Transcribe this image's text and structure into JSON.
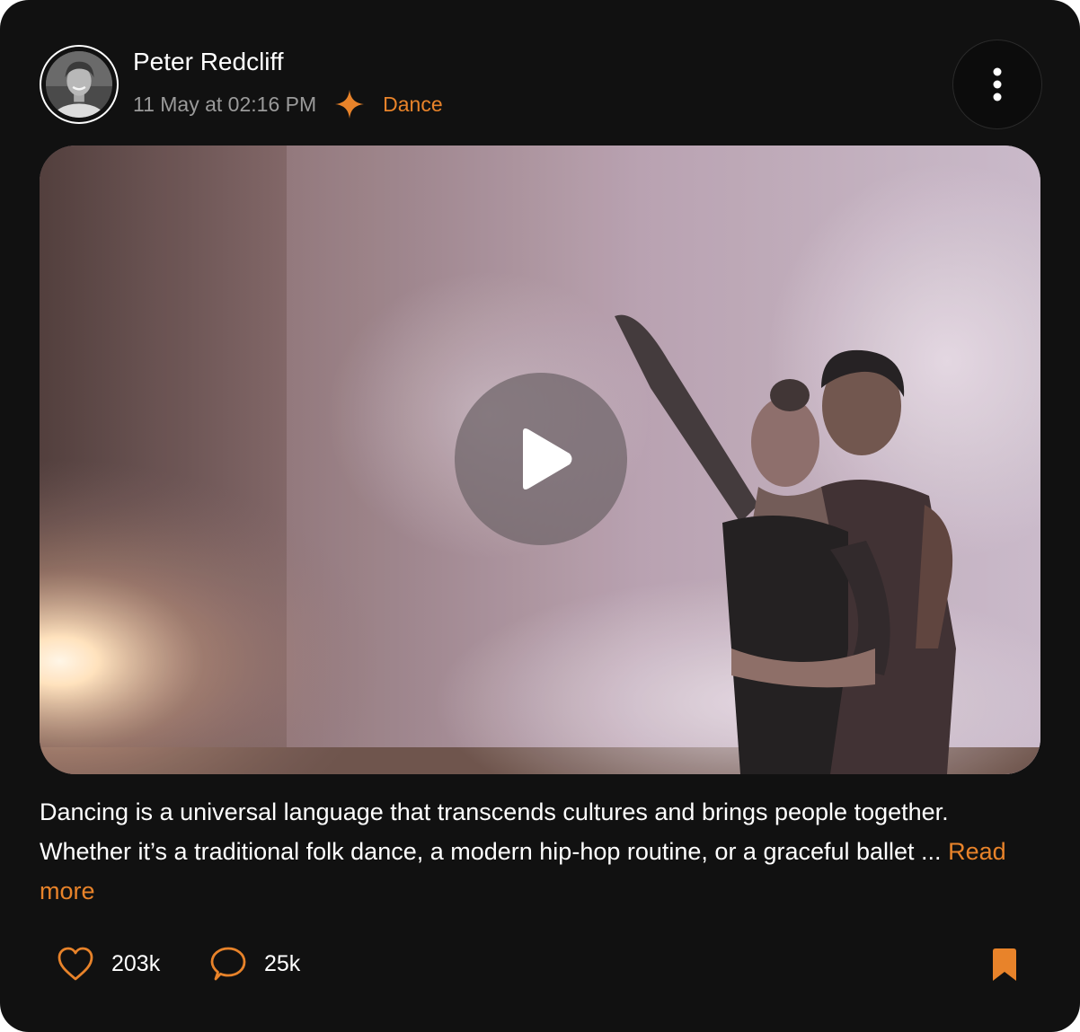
{
  "post": {
    "author": {
      "name": "Peter Redcliff",
      "avatar_icon": "avatar-photo"
    },
    "timestamp": "11 May at 02:16 PM",
    "category": {
      "label": "Dance",
      "icon": "sparkle-icon"
    },
    "menu_icon": "more-vertical-icon",
    "media": {
      "type": "video",
      "play_icon": "play-icon"
    },
    "caption": {
      "text": "Dancing is a universal language that transcends cultures and brings people together. Whether it’s a traditional folk dance, a modern hip-hop routine, or a graceful ballet ...",
      "read_more": "Read more"
    },
    "actions": {
      "likes": {
        "icon": "heart-icon",
        "count": "203k"
      },
      "comments": {
        "icon": "comment-icon",
        "count": "25k"
      },
      "bookmark": {
        "icon": "bookmark-icon"
      }
    }
  },
  "colors": {
    "background": "#111111",
    "accent": "#e8832a",
    "muted_text": "#9a9a9a",
    "text": "#ffffff"
  }
}
